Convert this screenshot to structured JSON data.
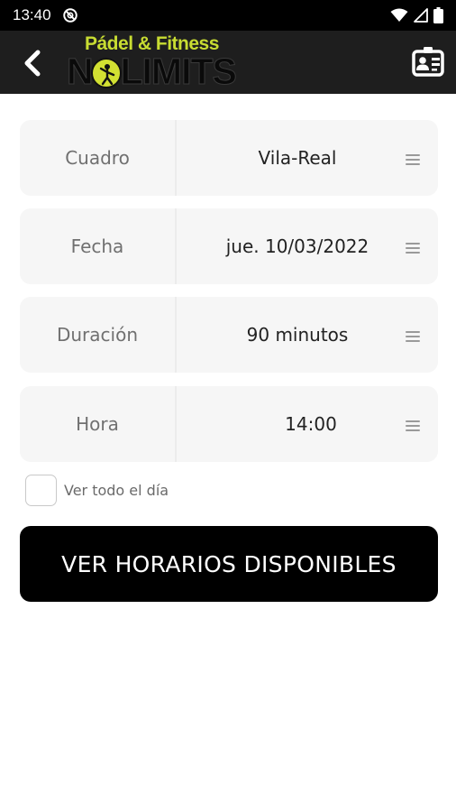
{
  "status_bar": {
    "time": "13:40",
    "icons": [
      "do-not-disturb-icon",
      "wifi-icon",
      "signal-icon",
      "battery-icon"
    ]
  },
  "app_bar": {
    "back_icon": "chevron-left-icon",
    "logo_top": "Pádel & Fitness",
    "logo_main": "NOLIMITS",
    "contact_icon": "contact-card-icon"
  },
  "form": {
    "rows": [
      {
        "label": "Cuadro",
        "value": "Vila-Real"
      },
      {
        "label": "Fecha",
        "value": "jue. 10/03/2022"
      },
      {
        "label": "Duración",
        "value": "90 minutos"
      },
      {
        "label": "Hora",
        "value": "14:00"
      }
    ],
    "all_day": {
      "label": "Ver todo el día",
      "checked": false
    },
    "submit_label": "VER HORARIOS DISPONIBLES"
  },
  "colors": {
    "status_bar": "#000000",
    "app_bar": "#1e1e1e",
    "brand_lime": "#c8dc32",
    "row_background": "#f6f6f6",
    "button": "#000000"
  }
}
